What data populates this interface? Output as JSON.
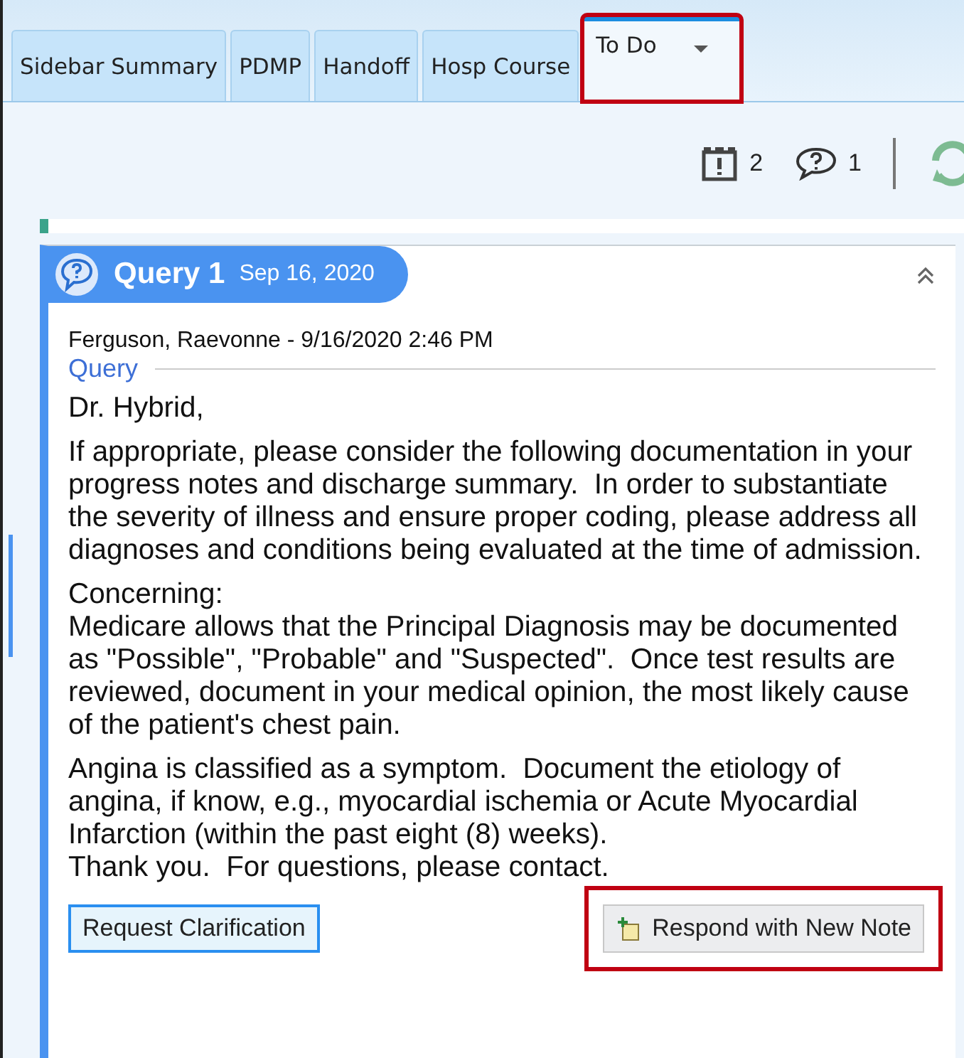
{
  "tabs": [
    {
      "label": "Sidebar Summary",
      "selected": false,
      "highlighted": false,
      "menu": false
    },
    {
      "label": "PDMP",
      "selected": false,
      "highlighted": false,
      "menu": false
    },
    {
      "label": "Handoff",
      "selected": false,
      "highlighted": false,
      "menu": false
    },
    {
      "label": "Hosp Course",
      "selected": false,
      "highlighted": false,
      "menu": false
    },
    {
      "label": "To Do",
      "selected": true,
      "highlighted": true,
      "menu": true
    }
  ],
  "toolbar": {
    "items": [
      {
        "kind": "alert",
        "count": "2"
      },
      {
        "kind": "query",
        "count": "1"
      },
      {
        "kind": "refresh"
      }
    ]
  },
  "query": {
    "title": "Query 1",
    "date": "Sep 16, 2020",
    "expanded": true,
    "author": "Ferguson, Raevonne - 9/16/2020 2:46 PM",
    "section": "Query",
    "paragraphs": [
      {
        "text": "Dr. Hybrid,",
        "gap": false
      },
      {
        "text": "If appropriate, please consider the following documentation in your progress notes and discharge summary.  In order to substantiate the severity of illness and ensure proper coding, please address all diagnoses and conditions being evaluated at the time of admission.",
        "gap": true
      },
      {
        "text": "Concerning:",
        "gap": true
      },
      {
        "text": "Medicare allows that the Principal Diagnosis may be documented as \"Possible\", \"Probable\" and \"Suspected\".  Once test results are reviewed, document in your medical opinion, the most likely cause of the patient's chest pain.",
        "gap": false
      },
      {
        "text": "Angina is classified as a symptom.  Document the etiology of angina, if know, e.g., myocardial ischemia or Acute Myocardial Infarction (within the past eight (8) weeks).",
        "gap": true
      },
      {
        "text": "Thank you.  For questions, please contact.",
        "gap": false
      }
    ],
    "buttons": [
      {
        "label": "Request Clarification",
        "kind": "focused",
        "highlighted": false
      },
      {
        "label": "Respond with New Note",
        "kind": "note",
        "highlighted": true
      }
    ]
  }
}
